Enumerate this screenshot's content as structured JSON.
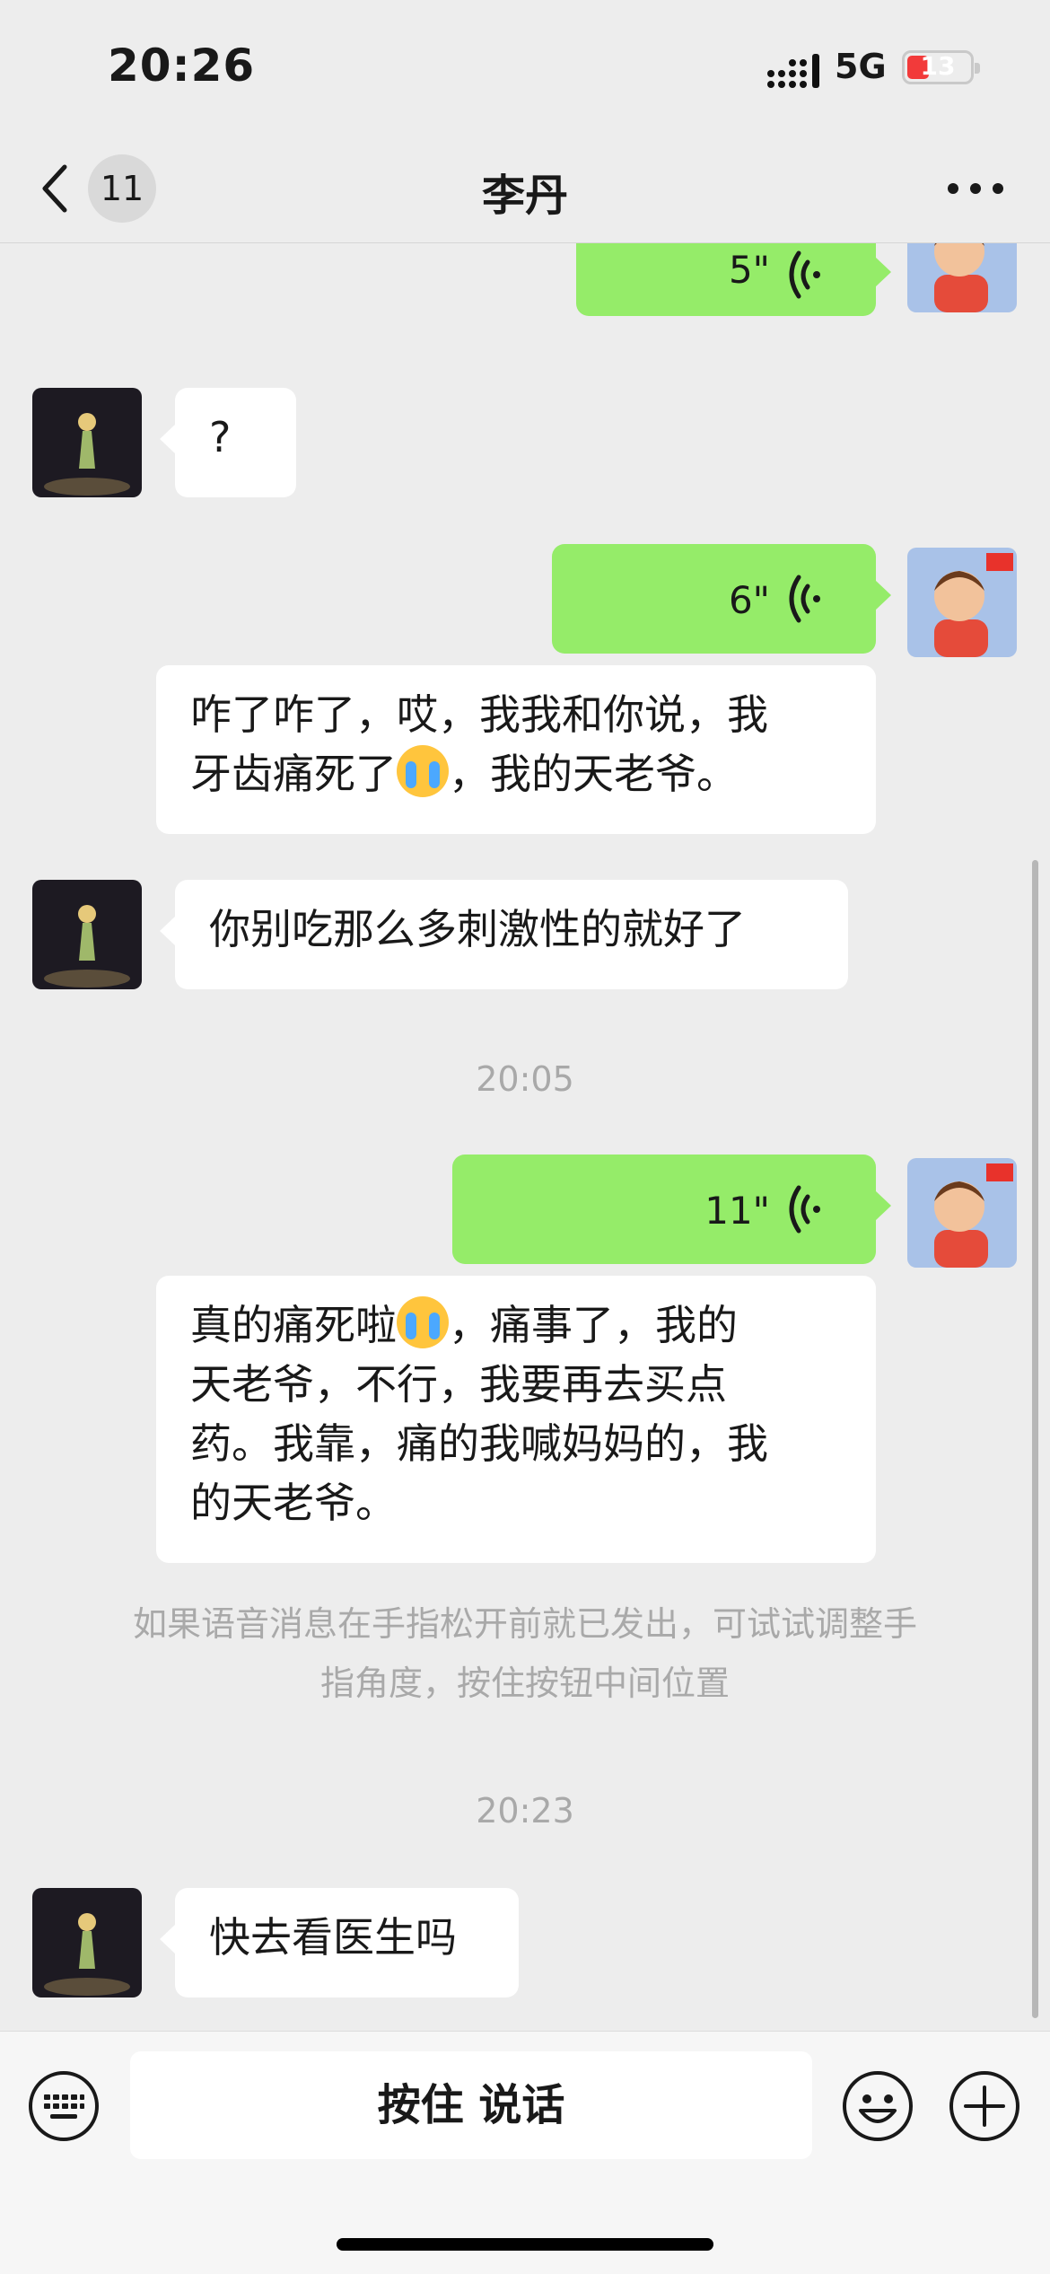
{
  "status_bar": {
    "time": "20:26",
    "network": "5G",
    "battery": "13",
    "battery_level": 0.13
  },
  "nav": {
    "back_icon": "chevron-left-icon",
    "unread_count": "11",
    "title": "李丹",
    "more_icon": "more-dots-icon"
  },
  "messages": [
    {
      "type": "voice",
      "side": "right",
      "duration": "5\""
    },
    {
      "type": "text",
      "side": "left",
      "text": "?"
    },
    {
      "type": "voice",
      "side": "right",
      "duration": "6\""
    },
    {
      "type": "text",
      "side": "right",
      "line1": "咋了咋了，哎，我我和你说，我",
      "line2_pre": "牙齿痛死了",
      "line2_post": "，我的天老爷。",
      "emoji": "crying-emoji"
    },
    {
      "type": "text",
      "side": "left",
      "text": "你别吃那么多刺激性的就好了"
    },
    {
      "type": "time",
      "text": "20:05"
    },
    {
      "type": "voice",
      "side": "right",
      "duration": "11\""
    },
    {
      "type": "text",
      "side": "right",
      "line1_pre": "真的痛死啦",
      "line1_post": "，痛事了，我的",
      "line2": "天老爷，不行，我要再去买点",
      "line3": "药。我靠，痛的我喊妈妈的，我",
      "line4": "的天老爷。",
      "emoji": "crying-emoji"
    },
    {
      "type": "system",
      "line1": "如果语音消息在手指松开前就已发出，可试试调整手",
      "line2": "指角度，按住按钮中间位置"
    },
    {
      "type": "time",
      "text": "20:23"
    },
    {
      "type": "text",
      "side": "left",
      "text": "快去看医生吗"
    }
  ],
  "input_bar": {
    "keyboard_icon": "keyboard-icon",
    "hold_to_talk": "按住 说话",
    "emoji_icon": "smiley-icon",
    "plus_icon": "plus-icon"
  },
  "colors": {
    "background": "#ededed",
    "self_bubble": "#95ec69",
    "other_bubble": "#ffffff",
    "timestamp": "#a9a9a9",
    "battery_low": "#f23a3a"
  }
}
